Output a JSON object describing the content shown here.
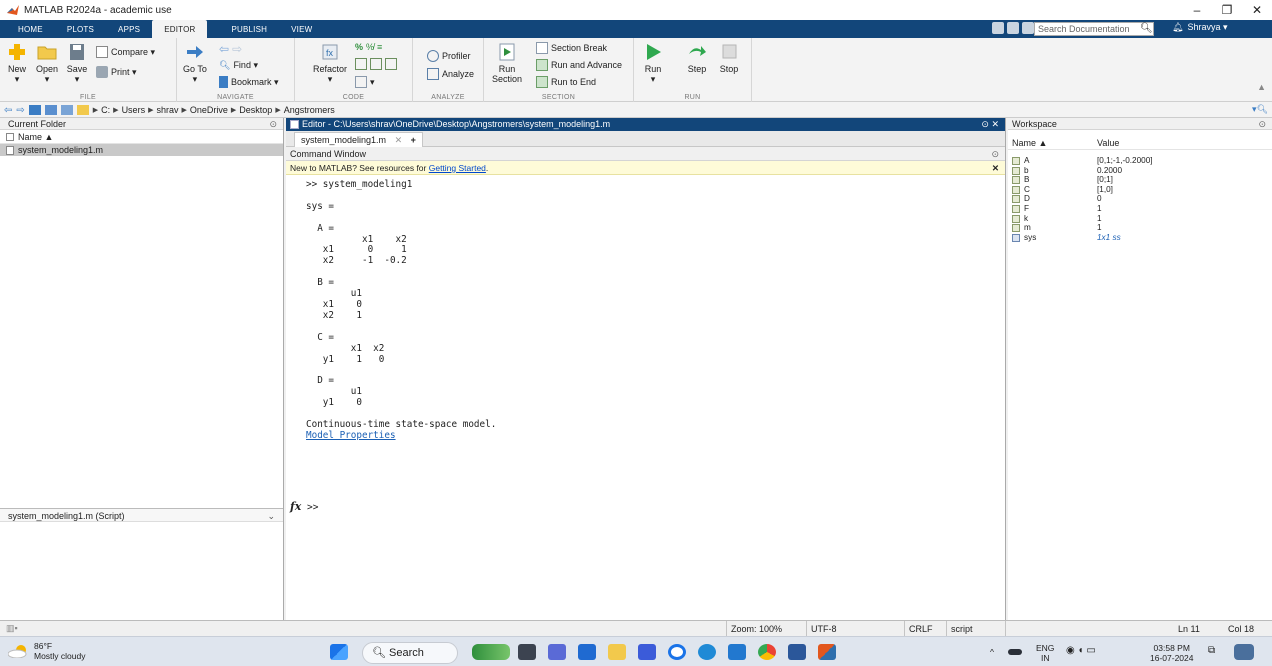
{
  "window": {
    "title": "MATLAB R2024a - academic use",
    "minimize": "–",
    "restore": "❐",
    "close": "✕"
  },
  "tabs": [
    {
      "label": "HOME",
      "active": false
    },
    {
      "label": "PLOTS",
      "active": false
    },
    {
      "label": "APPS",
      "active": false
    },
    {
      "label": "EDITOR",
      "active": true
    },
    {
      "label": "PUBLISH",
      "active": false
    },
    {
      "label": "VIEW",
      "active": false
    }
  ],
  "search_doc": {
    "placeholder": "Search Documentation"
  },
  "user": {
    "name": "Shravya ▾"
  },
  "ribbon": {
    "file": {
      "group": "FILE",
      "new": "New",
      "open": "Open",
      "save": "Save",
      "compare": "Compare ▾",
      "print": "Print ▾"
    },
    "navigate": {
      "group": "NAVIGATE",
      "goto": "Go To",
      "find": "Find ▾",
      "bookmark": "Bookmark ▾"
    },
    "code": {
      "group": "CODE",
      "refactor": "Refactor"
    },
    "analyze": {
      "group": "ANALYZE",
      "profiler": "Profiler",
      "analyze": "Analyze"
    },
    "section": {
      "group": "SECTION",
      "run_section_1": "Run",
      "run_section_2": "Section",
      "section_break": "Section Break",
      "run_advance": "Run and Advance",
      "run_end": "Run to End"
    },
    "run": {
      "group": "RUN",
      "run": "Run",
      "step": "Step",
      "stop": "Stop"
    }
  },
  "breadcrumb": [
    "C:",
    "Users",
    "shrav",
    "OneDrive",
    "Desktop",
    "Angstromers"
  ],
  "current_folder": {
    "title": "Current Folder",
    "column": "Name ▲",
    "files": [
      "system_modeling1.m"
    ],
    "detail": "system_modeling1.m  (Script)"
  },
  "editor": {
    "title": "Editor - C:\\Users\\shrav\\OneDrive\\Desktop\\Angstromers\\system_modeling1.m",
    "tab": "system_modeling1.m",
    "tab_close": "✕",
    "add_tab": "+"
  },
  "command_window": {
    "title": "Command Window",
    "notice_text": "New to MATLAB? See resources for ",
    "notice_link": "Getting Started",
    "notice_end": ".",
    "output": ">> system_modeling1\n\nsys =\n\n  A = \n          x1    x2\n   x1      0     1\n   x2     -1  -0.2\n\n  B = \n        u1\n   x1    0\n   x2    1\n\n  C = \n        x1  x2\n   y1    1   0\n\n  D = \n        u1\n   y1    0\n\nContinuous-time state-space model.",
    "model_properties_link": "Model Properties",
    "prompt": ">>"
  },
  "workspace": {
    "title": "Workspace",
    "col_name": "Name ▲",
    "col_value": "Value",
    "vars": [
      {
        "name": "A",
        "value": "[0,1;-1,-0.2000]"
      },
      {
        "name": "b",
        "value": "0.2000"
      },
      {
        "name": "B",
        "value": "[0;1]"
      },
      {
        "name": "C",
        "value": "[1,0]"
      },
      {
        "name": "D",
        "value": "0"
      },
      {
        "name": "F",
        "value": "1"
      },
      {
        "name": "k",
        "value": "1"
      },
      {
        "name": "m",
        "value": "1"
      },
      {
        "name": "sys",
        "value": "1x1 ss"
      }
    ]
  },
  "status": {
    "zoom": "Zoom: 100%",
    "encoding": "UTF-8",
    "eol": "CRLF",
    "mode": "script",
    "line": "Ln  11",
    "col": "Col  18"
  },
  "taskbar": {
    "weather_temp": "86°F",
    "weather_desc": "Mostly cloudy",
    "search": "Search",
    "lang_1": "ENG",
    "lang_2": "IN",
    "time": "03:58 PM",
    "date": "16-07-2024"
  }
}
